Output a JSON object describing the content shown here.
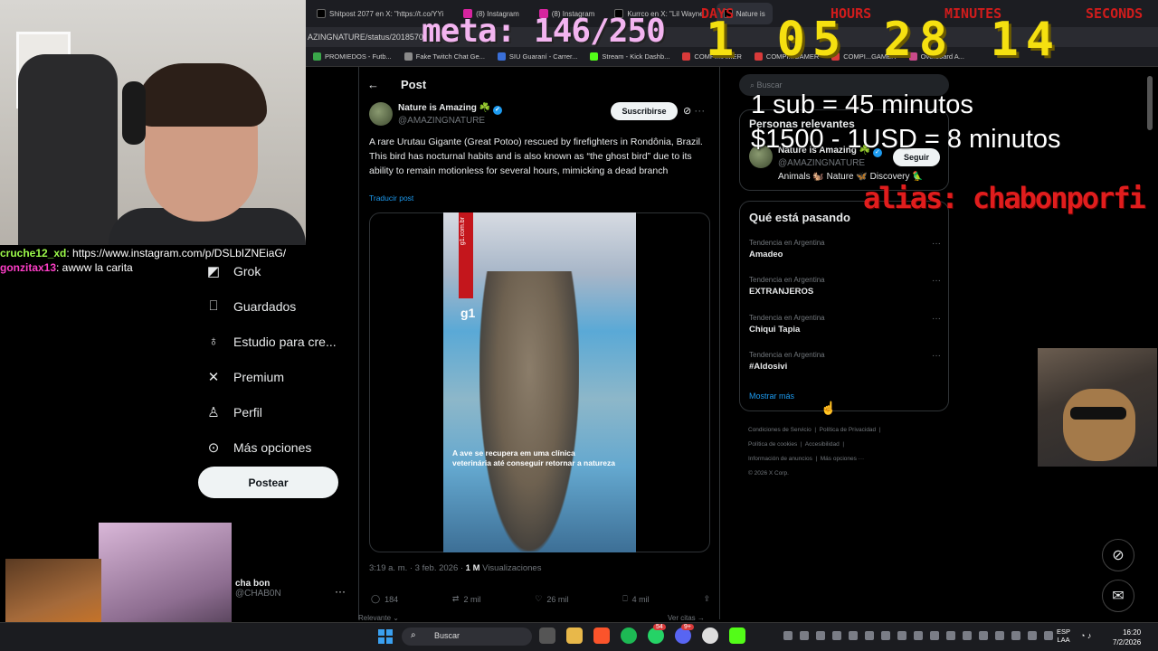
{
  "browser": {
    "tabs": [
      {
        "label": "Shitpost 2077 en X: \"https://t.co/YYi"
      },
      {
        "label": "(8) Instagram"
      },
      {
        "label": "(8) Instagram"
      },
      {
        "label": "Kurrco en X: \"Lil Wayne"
      },
      {
        "label": "Nature is"
      }
    ],
    "address": "AZINGNATURE/status/2018570",
    "bookmarks": [
      "PROMIEDOS - Futb...",
      "Fake Twitch Chat Ge...",
      "SIU Guaraní - Carrer...",
      "Stream - Kick Dashb...",
      "COMPI...AMER",
      "COMPI...GAMER",
      "COMPI...GAMER",
      "Overboard A..."
    ]
  },
  "stream": {
    "goal": "meta: 146/250",
    "timer_labels": [
      "DAYS",
      "HOURS",
      "MINUTES",
      "SECONDS"
    ],
    "timer": "1 05 28 14",
    "rule_sub": "1 sub = 45 minutos",
    "rule_money": "$1500 - 1USD = 8 minutos",
    "alias": "alias: chabonporfi"
  },
  "chat": [
    {
      "user": "cruche12_xd",
      "user_color": "#9cfa4a",
      "text": ": https://www.instagram.com/p/DSLbIZNEiaG/"
    },
    {
      "user": "gonzitax13",
      "user_color": "#ff3ec8",
      "text": ": awww la carita"
    }
  ],
  "sidebar": {
    "items": [
      {
        "label": "Grok",
        "icon": "grok-icon"
      },
      {
        "label": "Guardados",
        "icon": "bookmark-icon"
      },
      {
        "label": "Estudio para cre...",
        "icon": "studio-icon"
      },
      {
        "label": "Premium",
        "icon": "x-logo-icon"
      },
      {
        "label": "Perfil",
        "icon": "person-icon"
      },
      {
        "label": "Más opciones",
        "icon": "more-circle-icon"
      }
    ],
    "post_button": "Postear",
    "account_name": "cha bon",
    "account_handle": "@CHAB0N"
  },
  "post": {
    "header": "Post",
    "author_name": "Nature is Amazing ☘️",
    "author_handle": "@AMAZINGNATURE",
    "subscribe": "Suscribirse",
    "text": "A rare Urutau Gigante (Great Potoo) rescued by firefighters in Rondônia, Brazil. This bird has nocturnal habits and is also known as “the ghost bird” due to its ability to remain motionless for several hours, mimicking a dead branch",
    "translate": "Traducir post",
    "video_watermark": "g1",
    "video_site": "g1.com.br",
    "video_caption": "A ave se recupera em uma clínica veterinária até conseguir retornar a natureza",
    "time": "3:19 a. m. · 3 feb. 2026 · ",
    "views_count": "1 M",
    "views_label": " Visualizaciones",
    "replies": "184",
    "reposts": "2 mil",
    "likes": "26 mil",
    "bookmarks": "4 mil",
    "relevant": "Relevante ⌄",
    "see_quotes": "Ver citas →"
  },
  "right": {
    "search_placeholder": "Buscar",
    "relevant_title": "Personas relevantes",
    "rel_name": "Nature is Amazing ☘️",
    "rel_handle": "@AMAZINGNATURE",
    "rel_follow": "Seguir",
    "rel_bio": "Animals 🐿️ Nature 🦋 Discovery 🦜",
    "trending_title": "Qué está pasando",
    "trends": [
      {
        "context": "Tendencia en Argentina",
        "name": "Amadeo"
      },
      {
        "context": "Tendencia en Argentina",
        "name": "EXTRANJEROS"
      },
      {
        "context": "Tendencia en Argentina",
        "name": "Chiqui Tapia"
      },
      {
        "context": "Tendencia en Argentina",
        "name": "#Aldosivi"
      }
    ],
    "show_more": "Mostrar más",
    "footer": [
      "Condiciones de Servicio",
      "Política de Privacidad",
      "Política de cookies",
      "Accesibilidad",
      "Información de anuncios",
      "Más opciones ···",
      "© 2026 X Corp."
    ]
  },
  "taskbar": {
    "search": "Buscar",
    "badge_whatsapp": "54",
    "badge_discord": "9+",
    "lang": "ESP",
    "lang2": "LAA",
    "time": "16:20",
    "date": "7/2/2026"
  },
  "colors": {
    "accent": "#1d9bf0",
    "timer": "#f5e010",
    "goal": "#f3b4f0",
    "alias": "#e01d1d"
  }
}
